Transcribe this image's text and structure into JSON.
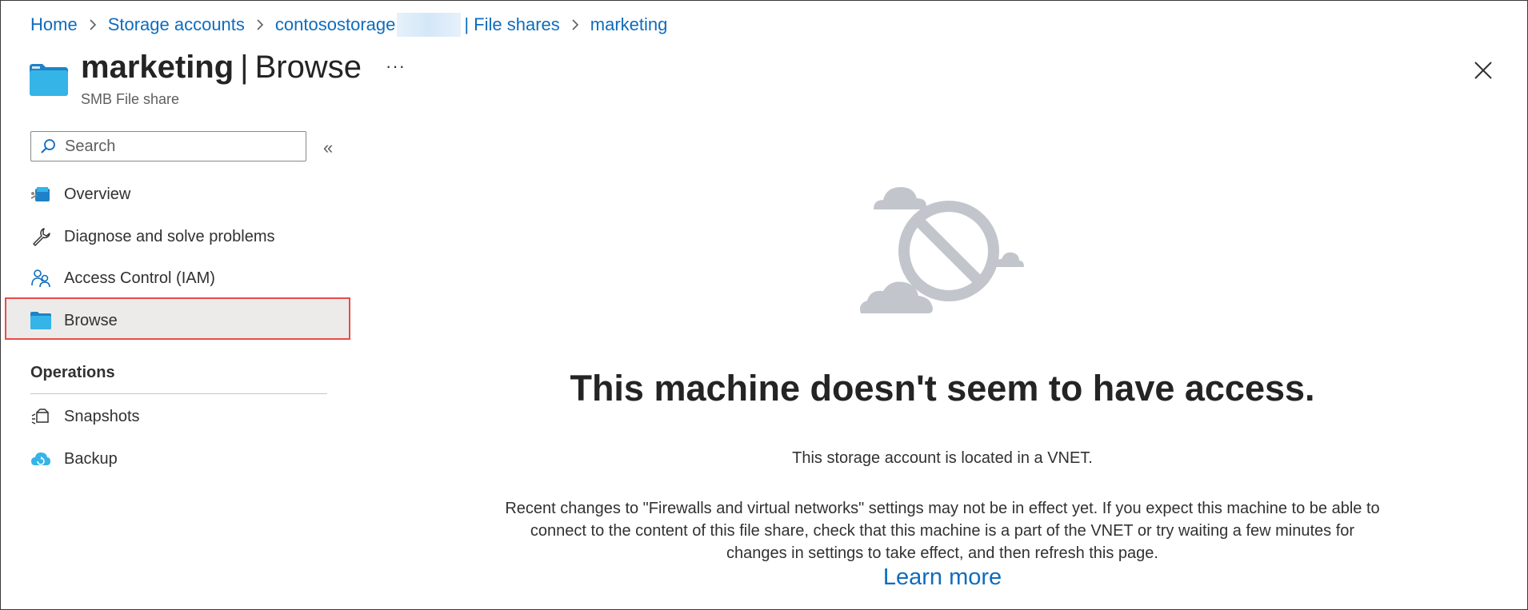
{
  "breadcrumb": {
    "items": [
      "Home",
      "Storage accounts",
      "contosostorage",
      "| File shares",
      "marketing"
    ]
  },
  "header": {
    "title_name": "marketing",
    "title_sep": "|",
    "title_view": "Browse",
    "more_label": "···",
    "subtitle": "SMB File share",
    "close_icon": "close-icon"
  },
  "sidebar": {
    "search_placeholder": "Search",
    "collapse_label": "«",
    "items": [
      {
        "label": "Overview",
        "icon": "overview-icon"
      },
      {
        "label": "Diagnose and solve problems",
        "icon": "wrench-icon"
      },
      {
        "label": "Access Control (IAM)",
        "icon": "people-icon"
      },
      {
        "label": "Browse",
        "icon": "folder-icon",
        "selected": true
      }
    ],
    "section_title": "Operations",
    "operations": [
      {
        "label": "Snapshots",
        "icon": "snapshots-icon"
      },
      {
        "label": "Backup",
        "icon": "backup-cloud-icon"
      }
    ]
  },
  "main": {
    "illustration_icon": "no-access-cloud-icon",
    "headline": "This machine doesn't seem to have access.",
    "subline": "This storage account is located in a VNET.",
    "paragraph_line1": "Recent changes to \"Firewalls and virtual networks\" settings may not be in effect yet. If you expect this machine to be able to",
    "paragraph_line2": "connect to the content of this file share, check that this machine is a part of the VNET or try waiting a few minutes for",
    "paragraph_line3": "changes in settings to take effect, and then refresh this page.",
    "learn_more": "Learn more"
  },
  "colors": {
    "link": "#0f6cbd",
    "selected_bg": "#edebe9",
    "highlight_border": "#e74c4c",
    "illustration_gray": "#c2c6cc"
  }
}
